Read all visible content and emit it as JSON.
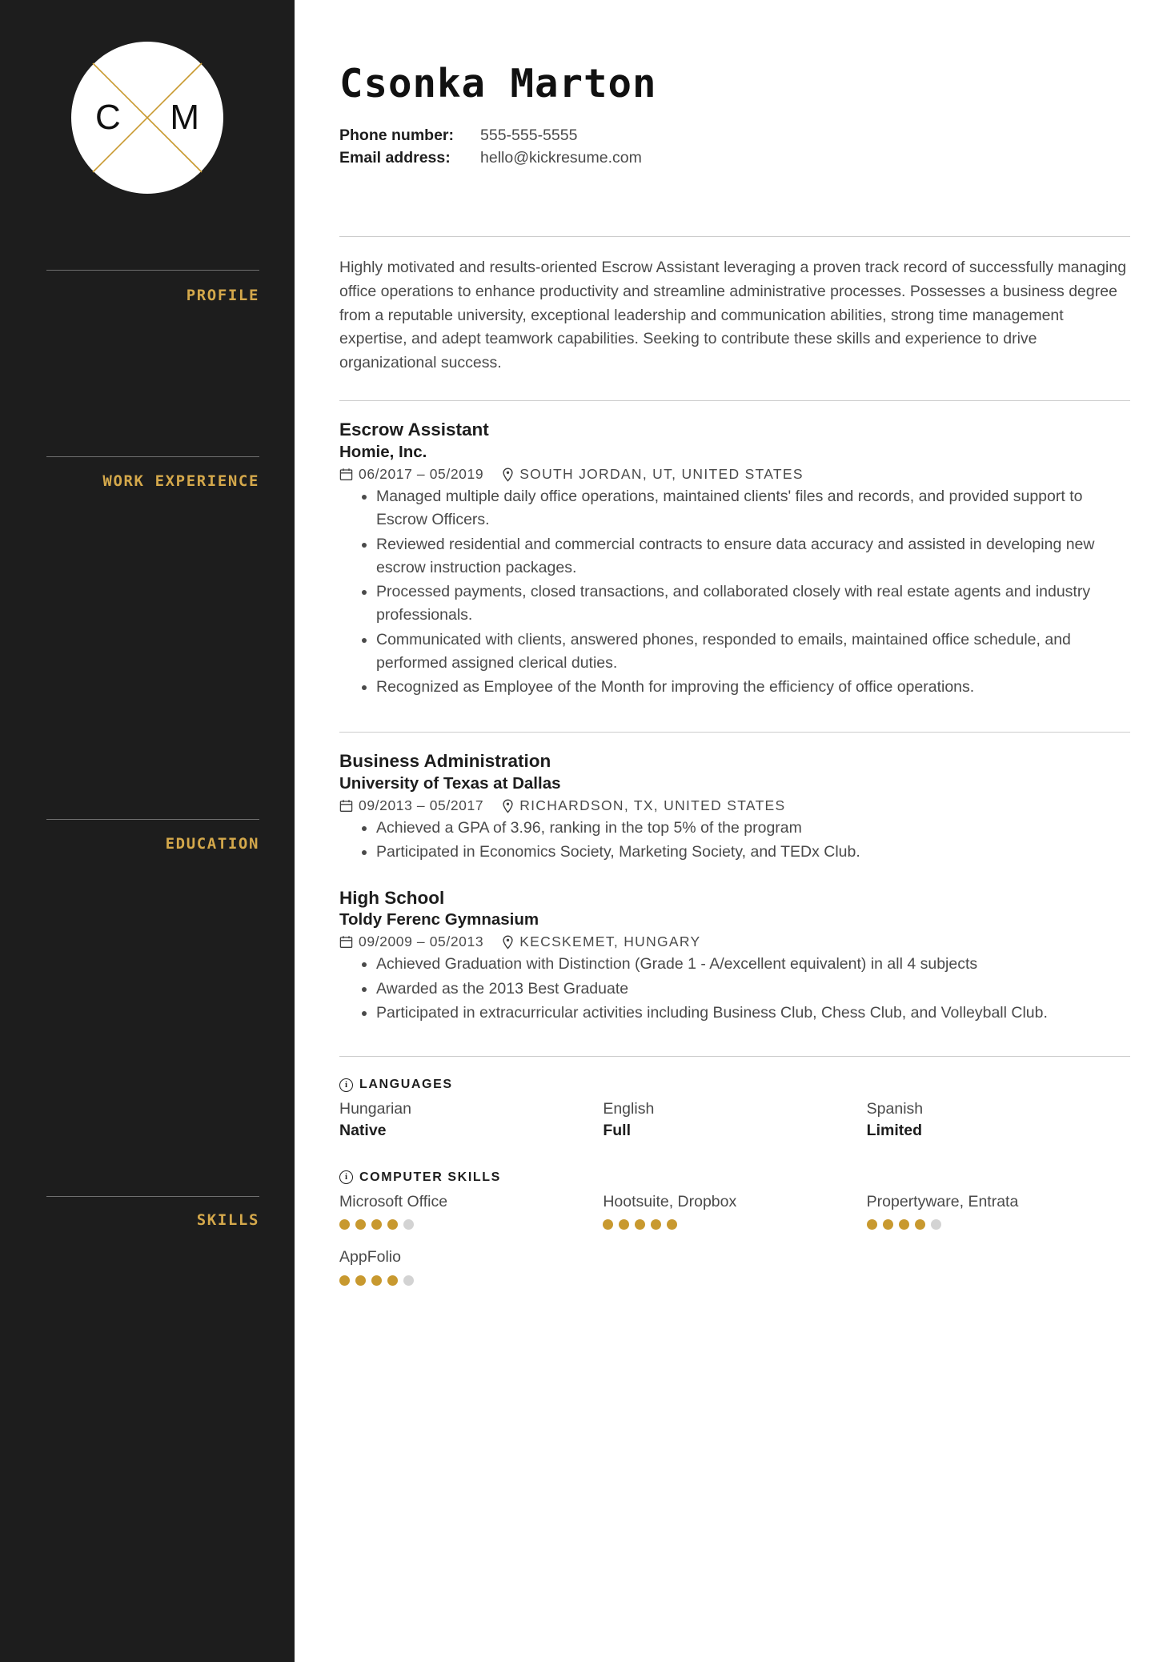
{
  "theme": {
    "sidebar_bg": "#1d1d1d",
    "accent_gold": "#d4a84b",
    "dot_filled": "#c8992f",
    "dot_empty": "#d3d3d3",
    "text_dark": "#1d1d1d",
    "text_body": "#4a4a4a"
  },
  "logo": {
    "initial_left": "C",
    "initial_right": "M"
  },
  "header": {
    "name": "Csonka Marton",
    "contacts": [
      {
        "label": "Phone number:",
        "value": "555-555-5555"
      },
      {
        "label": "Email address:",
        "value": "hello@kickresume.com"
      }
    ]
  },
  "sidebar": {
    "labels": [
      "PROFILE",
      "WORK EXPERIENCE",
      "EDUCATION",
      "SKILLS"
    ]
  },
  "profile": {
    "text": "Highly motivated and results-oriented Escrow Assistant leveraging a proven track record of successfully managing office operations to enhance productivity and streamline administrative processes. Possesses a business degree from a reputable university, exceptional leadership and communication abilities, strong time management expertise, and adept teamwork capabilities. Seeking to contribute these skills and experience to drive organizational success."
  },
  "work_experience": [
    {
      "title": "Escrow Assistant",
      "organization": "Homie, Inc.",
      "date": "06/2017 – 05/2019",
      "location": "SOUTH JORDAN, UT, UNITED STATES",
      "bullets": [
        "Managed multiple daily office operations, maintained clients' files and records, and provided support to Escrow Officers.",
        "Reviewed residential and commercial contracts to ensure data accuracy and assisted in developing new escrow instruction packages.",
        "Processed payments, closed transactions, and collaborated closely with real estate agents and industry professionals.",
        "Communicated with clients, answered phones, responded to emails, maintained office schedule, and performed assigned clerical duties.",
        "Recognized as Employee of the Month for improving the efficiency of office operations."
      ]
    }
  ],
  "education": [
    {
      "title": "Business Administration",
      "organization": "University of Texas at Dallas",
      "date": "09/2013 – 05/2017",
      "location": "RICHARDSON, TX, UNITED STATES",
      "bullets": [
        "Achieved a GPA of 3.96, ranking in the top 5% of the program",
        "Participated in Economics Society, Marketing Society, and TEDx Club."
      ]
    },
    {
      "title": "High School",
      "organization": "Toldy Ferenc Gymnasium",
      "date": "09/2009 – 05/2013",
      "location": "KECSKEMET, HUNGARY",
      "bullets": [
        "Achieved Graduation with Distinction (Grade 1 - A/excellent equivalent) in all 4 subjects",
        "Awarded as the 2013 Best Graduate",
        "Participated in extracurricular activities including Business Club, Chess Club, and Volleyball Club."
      ]
    }
  ],
  "skills": {
    "languages": {
      "heading": "LANGUAGES",
      "items": [
        {
          "name": "Hungarian",
          "level": "Native"
        },
        {
          "name": "English",
          "level": "Full"
        },
        {
          "name": "Spanish",
          "level": "Limited"
        }
      ]
    },
    "computer_skills": {
      "heading": "COMPUTER SKILLS",
      "max_rating": 5,
      "items": [
        {
          "name": "Microsoft Office",
          "rating": 4
        },
        {
          "name": "Hootsuite, Dropbox",
          "rating": 5
        },
        {
          "name": "Propertyware, Entrata",
          "rating": 4
        },
        {
          "name": "AppFolio",
          "rating": 4
        }
      ]
    }
  }
}
